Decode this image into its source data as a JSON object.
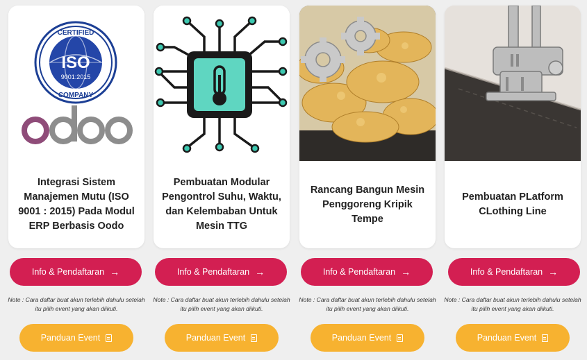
{
  "colors": {
    "info_button": "#d31f52",
    "guide_button": "#f7b230",
    "card": "#ffffff",
    "background": "#efefef"
  },
  "cards": [
    {
      "title": "Integrasi Sistem Manajemen Mutu (ISO 9001 : 2015) Pada Modul ERP Berbasis Oodo",
      "image": {
        "cert_top": "CERTIFIED",
        "cert_mid": "ISO",
        "cert_num": "9001:2015",
        "cert_bottom": "COMPANY",
        "logo": "odoo"
      },
      "info_label": "Info & Pendaftaran",
      "note": "Note : Cara daftar buat akun terlebih dahulu setelah itu pilih event yang akan diikuti.",
      "guide_label": "Panduan Event"
    },
    {
      "title": "Pembuatan Modular Pengontrol Suhu, Waktu, dan Kelembaban Untuk Mesin TTG",
      "image": {
        "icon": "thermometer-chip-icon"
      },
      "info_label": "Info & Pendaftaran",
      "note": "Note : Cara daftar buat akun terlebih dahulu setelah itu pilih event yang akan diikuti.",
      "guide_label": "Panduan Event"
    },
    {
      "title": "Rancang Bangun Mesin Penggoreng Kripik Tempe",
      "image": {
        "icon": "gears-chips-photo"
      },
      "info_label": "Info & Pendaftaran",
      "note": "Note : Cara daftar buat akun terlebih dahulu setelah itu pilih event yang akan diikuti.",
      "guide_label": "Panduan Event"
    },
    {
      "title": "Pembuatan PLatform CLothing Line",
      "image": {
        "icon": "sewing-machine-photo"
      },
      "info_label": "Info & Pendaftaran",
      "note": "Note : Cara daftar buat akun terlebih dahulu setelah itu pilih event yang akan diikuti.",
      "guide_label": "Panduan Event"
    }
  ]
}
